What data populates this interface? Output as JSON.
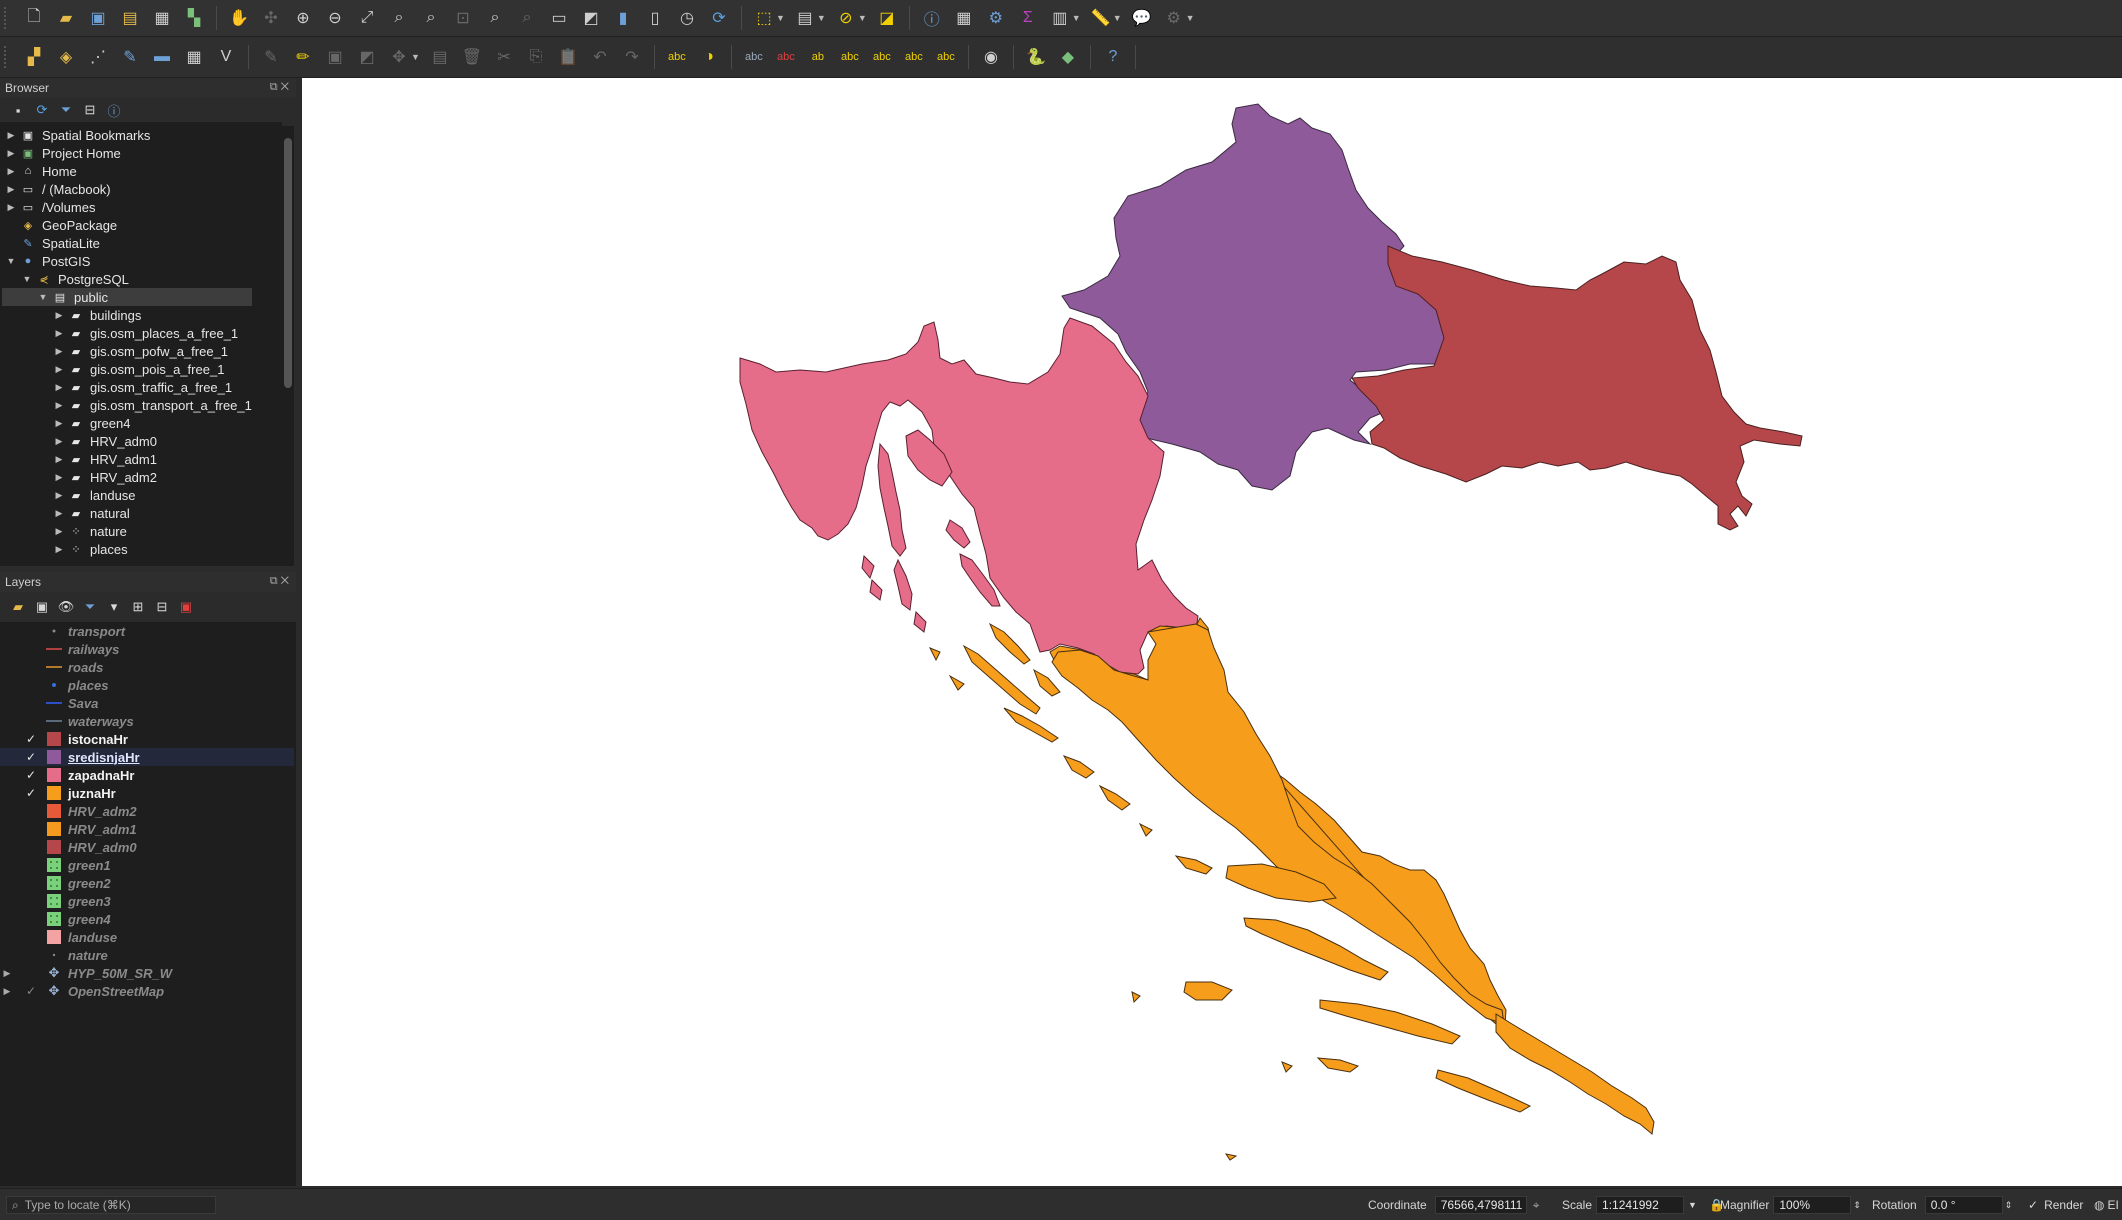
{
  "toolbar1": {
    "icons": [
      "new-project",
      "open-project",
      "save-project",
      "save-as",
      "print-layout",
      "style-manager",
      "pan",
      "pan-to-selection",
      "zoom-in",
      "zoom-out",
      "zoom-full",
      "zoom-layer",
      "zoom-selection",
      "zoom-last",
      "zoom-next",
      "zoom-native",
      "new-map-view",
      "new-3d-view",
      "new-bookmark",
      "show-bookmarks",
      "temporal",
      "refresh",
      "select-features",
      "select-by-value",
      "deselect",
      "select-location",
      "identify",
      "attribute-table",
      "toolbox",
      "statistics",
      "open-field-calc",
      "measure",
      "map-tips",
      "show-layout"
    ]
  },
  "toolbar2": {
    "icons": [
      "data-source-manager",
      "new-geopackage",
      "new-temp-scratch",
      "new-shapefile",
      "new-spatialite",
      "new-virtual",
      "virtual-layer",
      "digitize-edits",
      "toggle-editing",
      "save-edits",
      "add-feature",
      "vertex-tool",
      "delete",
      "cut",
      "copy",
      "paste",
      "undo",
      "redo",
      "label",
      "diagram",
      "pin-labels",
      "show-hide-labels",
      "move-label",
      "rotate-label",
      "change-label",
      "label-options",
      "georeferencer",
      "python-console",
      "plugins",
      "help"
    ]
  },
  "browser": {
    "title": "Browser",
    "items": [
      {
        "label": "Spatial Bookmarks"
      },
      {
        "label": "Project Home"
      },
      {
        "label": "Home"
      },
      {
        "label": "/ (Macbook)"
      },
      {
        "label": "/Volumes"
      },
      {
        "label": "GeoPackage"
      },
      {
        "label": "SpatiaLite"
      },
      {
        "label": "PostGIS"
      },
      {
        "label": "PostgreSQL"
      },
      {
        "label": "public"
      },
      {
        "label": "buildings"
      },
      {
        "label": "gis.osm_places_a_free_1"
      },
      {
        "label": "gis.osm_pofw_a_free_1"
      },
      {
        "label": "gis.osm_pois_a_free_1"
      },
      {
        "label": "gis.osm_traffic_a_free_1"
      },
      {
        "label": "gis.osm_transport_a_free_1"
      },
      {
        "label": "green4"
      },
      {
        "label": "HRV_adm0"
      },
      {
        "label": "HRV_adm1"
      },
      {
        "label": "HRV_adm2"
      },
      {
        "label": "landuse"
      },
      {
        "label": "natural"
      },
      {
        "label": "nature"
      },
      {
        "label": "places"
      }
    ]
  },
  "layers": {
    "title": "Layers",
    "items": [
      {
        "label": "transport",
        "checked": false,
        "color": "#888888"
      },
      {
        "label": "railways",
        "checked": false,
        "color": "#b04040"
      },
      {
        "label": "roads",
        "checked": false,
        "color": "#b07a2a"
      },
      {
        "label": "places",
        "checked": false,
        "color": "#3b6bd6"
      },
      {
        "label": "Sava",
        "checked": false,
        "color": "#2b4fc9"
      },
      {
        "label": "waterways",
        "checked": false,
        "color": "#5a6a7a"
      },
      {
        "label": "istocnaHr",
        "checked": true,
        "color": "#b5474b"
      },
      {
        "label": "sredisnjaHr",
        "checked": true,
        "color": "#8e5a9a"
      },
      {
        "label": "zapadnaHr",
        "checked": true,
        "color": "#e56d8a"
      },
      {
        "label": "juznaHr",
        "checked": true,
        "color": "#f69d1c"
      },
      {
        "label": "HRV_adm2",
        "checked": false,
        "color": "#e65a3a"
      },
      {
        "label": "HRV_adm1",
        "checked": false,
        "color": "#f59a1f"
      },
      {
        "label": "HRV_adm0",
        "checked": false,
        "color": "#b5474b"
      },
      {
        "label": "green1",
        "checked": false,
        "color": "#7bd07b"
      },
      {
        "label": "green2",
        "checked": false,
        "color": "#7bd07b"
      },
      {
        "label": "green3",
        "checked": false,
        "color": "#7bd07b"
      },
      {
        "label": "green4",
        "checked": false,
        "color": "#7bd07b"
      },
      {
        "label": "landuse",
        "checked": false,
        "color": "#f4a3a3"
      },
      {
        "label": "nature",
        "checked": false,
        "color": "#888888"
      },
      {
        "label": "HYP_50M_SR_W",
        "checked": false,
        "color": "#9ab"
      },
      {
        "label": "OpenStreetMap",
        "checked": true,
        "color": "#9ab"
      }
    ]
  },
  "map": {
    "regions": [
      {
        "name": "sredisnjaHr",
        "color": "#8e5a9a"
      },
      {
        "name": "istocnaHr",
        "color": "#b5474b"
      },
      {
        "name": "zapadnaHr",
        "color": "#e56d8a"
      },
      {
        "name": "juznaHr",
        "color": "#f69d1c"
      }
    ]
  },
  "status": {
    "locator_placeholder": "Type to locate (⌘K)",
    "coordinate_label": "Coordinate",
    "coordinate_value": "76566,4798111",
    "scale_label": "Scale",
    "scale_value": "1:1241992",
    "magnifier_label": "Magnifier",
    "magnifier_value": "100%",
    "rotation_label": "Rotation",
    "rotation_value": "0.0 °",
    "render_label": "Render",
    "epsg_label": "EI"
  }
}
